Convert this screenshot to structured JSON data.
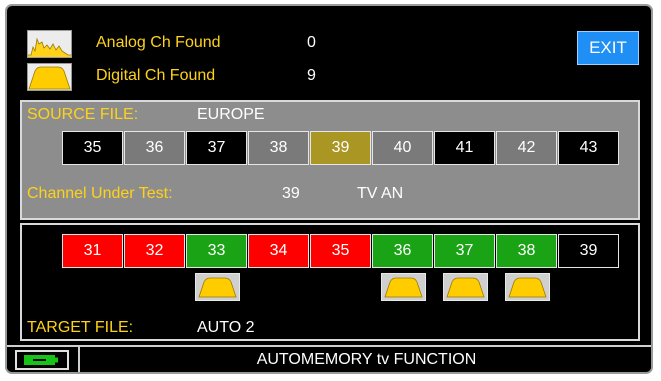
{
  "header": {
    "analog_label": "Analog Ch Found",
    "analog_value": "0",
    "digital_label": "Digital Ch Found",
    "digital_value": "9",
    "exit_label": "EXIT"
  },
  "source": {
    "file_label": "SOURCE FILE:",
    "file_value": "EUROPE",
    "channels": [
      {
        "num": "35",
        "color": "#000000"
      },
      {
        "num": "36",
        "color": "#7a7a7a"
      },
      {
        "num": "37",
        "color": "#000000"
      },
      {
        "num": "38",
        "color": "#7a7a7a"
      },
      {
        "num": "39",
        "color": "#a99623"
      },
      {
        "num": "40",
        "color": "#7a7a7a"
      },
      {
        "num": "41",
        "color": "#000000"
      },
      {
        "num": "42",
        "color": "#7a7a7a"
      },
      {
        "num": "43",
        "color": "#000000"
      }
    ],
    "test_label": "Channel Under Test:",
    "test_channel": "39",
    "test_type": "TV AN"
  },
  "target": {
    "channels": [
      {
        "num": "31",
        "color": "#ff0000",
        "found": false
      },
      {
        "num": "32",
        "color": "#ff0000",
        "found": false
      },
      {
        "num": "33",
        "color": "#1aa314",
        "found": true
      },
      {
        "num": "34",
        "color": "#ff0000",
        "found": false
      },
      {
        "num": "35",
        "color": "#ff0000",
        "found": false
      },
      {
        "num": "36",
        "color": "#1aa314",
        "found": true
      },
      {
        "num": "37",
        "color": "#1aa314",
        "found": true
      },
      {
        "num": "38",
        "color": "#1aa314",
        "found": true
      },
      {
        "num": "39",
        "color": "#000000",
        "found": false
      }
    ],
    "file_label": "TARGET FILE:",
    "file_value": "AUTO 2"
  },
  "status": {
    "title": "AUTOMEMORY tv FUNCTION",
    "battery_icon": "battery-icon"
  },
  "colors": {
    "accent_yellow": "#ffd21a",
    "exit_blue": "#1f8ef5",
    "digital_icon": "#ffcc00"
  }
}
